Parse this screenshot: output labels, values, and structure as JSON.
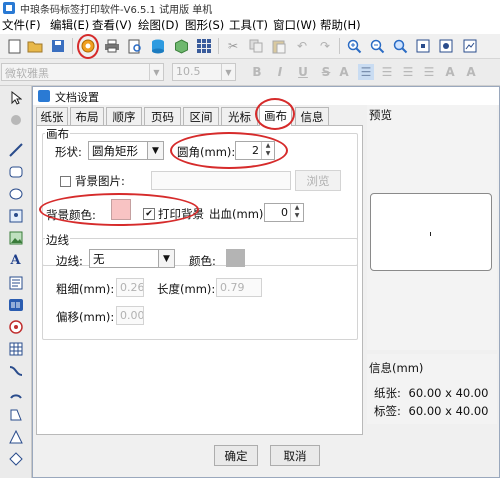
{
  "window": {
    "title": "中琅条码标签打印软件-V6.5.1 试用版 单机"
  },
  "menu": [
    "文件(F)",
    "编辑(E)",
    "查看(V)",
    "绘图(D)",
    "图形(S)",
    "工具(T)",
    "窗口(W)",
    "帮助(H)"
  ],
  "format_bar": {
    "font_name": "微软雅黑",
    "font_size": "10.5",
    "bold": "B",
    "italic": "I",
    "underline": "U",
    "strike": "S",
    "size_up": "A",
    "size_down": "A",
    "color": "A"
  },
  "dialog": {
    "title": "文档设置",
    "tabs": [
      "纸张",
      "布局",
      "顺序",
      "页码",
      "区间",
      "光标",
      "画布",
      "信息"
    ],
    "active_tab": "画布",
    "canvas_group": {
      "legend": "画布",
      "shape_label": "形状:",
      "shape_value": "圆角矩形",
      "corner_label": "圆角(mm):",
      "corner_value": "2",
      "bg_image_label": "背景图片:",
      "browse_label": "浏览",
      "bg_color_label": "背景颜色:",
      "bg_color": "#f8c3c3",
      "print_bg_label": "打印背景",
      "print_bg_checked": "✔",
      "bleed_label": "出血(mm):",
      "bleed_value": "0"
    },
    "border_group": {
      "legend": "边线",
      "line_label": "边线:",
      "line_value": "无",
      "color_label": "颜色:",
      "line_color": "#b4b4b4",
      "thickness_label": "粗细(mm):",
      "thickness_value": "0.26",
      "length_label": "长度(mm):",
      "length_value": "0.79",
      "offset_label": "偏移(mm):",
      "offset_value": "0.00"
    },
    "preview_label": "预览",
    "info": {
      "title": "信息(mm)",
      "paper_label": "纸张:",
      "paper_value": "60.00 x 40.00",
      "label_label": "标签:",
      "label_value": "60.00 x 40.00"
    },
    "ok_label": "确定",
    "cancel_label": "取消"
  },
  "annotation_color": "#d62b2b"
}
